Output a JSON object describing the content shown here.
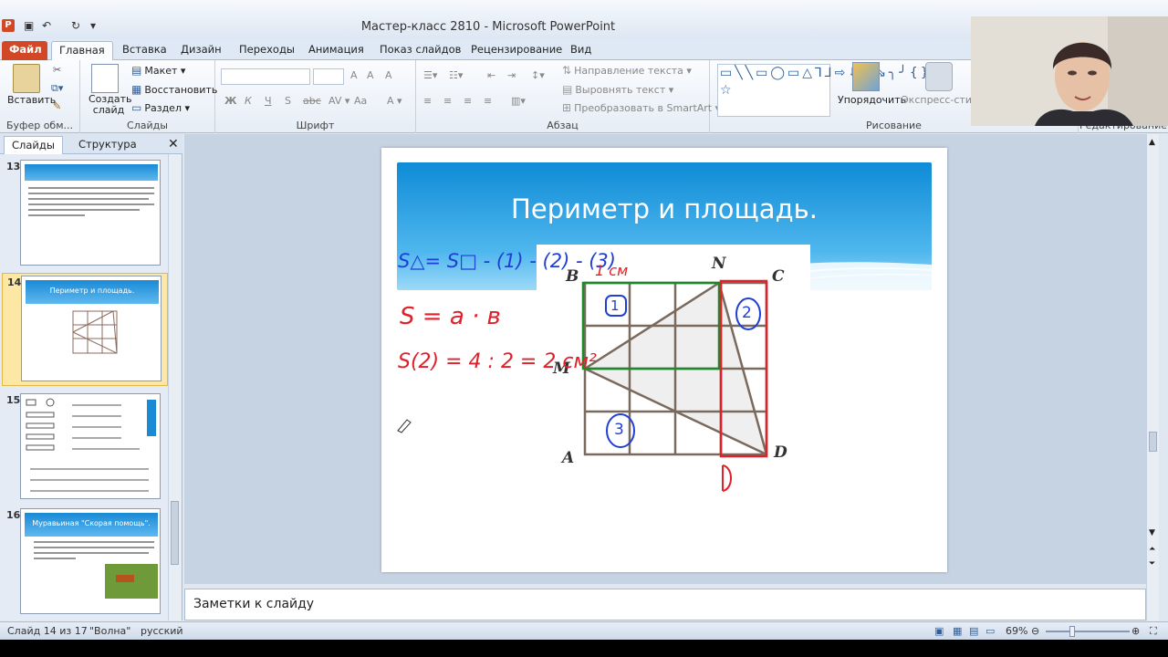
{
  "window": {
    "title": "Мастер-класс 2810  -  Microsoft PowerPoint"
  },
  "ribbon_tabs": [
    "Файл",
    "Главная",
    "Вставка",
    "Дизайн",
    "Переходы",
    "Анимация",
    "Показ слайдов",
    "Рецензирование",
    "Вид"
  ],
  "clipboard": {
    "paste": "Вставить",
    "label": "Буфер обм..."
  },
  "slides_group": {
    "new_slide": "Создать слайд",
    "layout": "Макет",
    "reset": "Восстановить",
    "section": "Раздел",
    "label": "Слайды"
  },
  "font_group": {
    "label": "Шрифт",
    "bold": "Ж",
    "italic": "К",
    "underline": "Ч",
    "strike": "S",
    "spacing": "abc",
    "case": "Aa",
    "grow": "A",
    "shrink": "A",
    "clear": "A"
  },
  "paragraph_group": {
    "label": "Абзац",
    "text_direction": "Направление текста",
    "align_text": "Выровнять текст",
    "smartart": "Преобразовать в SmartArt"
  },
  "drawing_group": {
    "label": "Рисование",
    "arrange": "Упорядочить",
    "quick_styles": "Экспресс-стили"
  },
  "editing_group": {
    "label": "Редактирование"
  },
  "panel_tabs": {
    "slides": "Слайды",
    "outline": "Структура"
  },
  "thumbnails": [
    {
      "num": "13"
    },
    {
      "num": "14",
      "title": "Периметр и площадь."
    },
    {
      "num": "15"
    },
    {
      "num": "16",
      "title": "Муравьиная \"Скорая помощь\"."
    }
  ],
  "slide": {
    "title": "Периметр и площадь.",
    "vertices": {
      "B": "B",
      "N": "N",
      "C": "C",
      "M": "M",
      "A": "A",
      "D": "D"
    },
    "ink": {
      "formula1": "S△= S□ - (1) - (2) - (3)",
      "unit": "1 см",
      "formula2": "S = a · в",
      "formula3": "S(2) = 4 : 2 = 2 см²",
      "circle1": "1",
      "circle2": "2",
      "circle3": "3"
    }
  },
  "notes": {
    "placeholder": "Заметки к слайду"
  },
  "status": {
    "slide_of": "Слайд 14 из 17",
    "theme": "\"Волна\"",
    "lang": "русский",
    "zoom": "69%"
  },
  "colors": {
    "file_tab": "#d24726",
    "banner": "#1a8ad5",
    "ink_blue": "#1f3fd6",
    "ink_red": "#e0202a",
    "green": "#1a8a2a"
  }
}
